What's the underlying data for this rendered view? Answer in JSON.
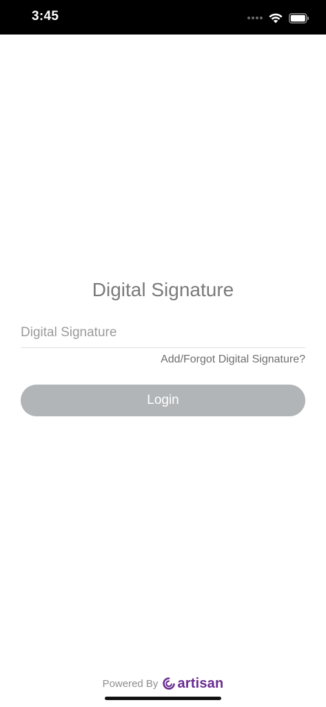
{
  "status_bar": {
    "time": "3:45",
    "icons": [
      "signal-dots-icon",
      "wifi-icon",
      "battery-icon"
    ]
  },
  "login": {
    "title": "Digital Signature",
    "signature_input": {
      "placeholder": "Digital Signature",
      "value": ""
    },
    "forgot_link": "Add/Forgot Digital Signature?",
    "login_button": "Login"
  },
  "footer": {
    "powered_by": "Powered By",
    "brand": "artisan",
    "brand_color": "#6a2c91"
  },
  "colors": {
    "button_bg": "#b2b5b8",
    "title_text": "#7a7a7a"
  }
}
